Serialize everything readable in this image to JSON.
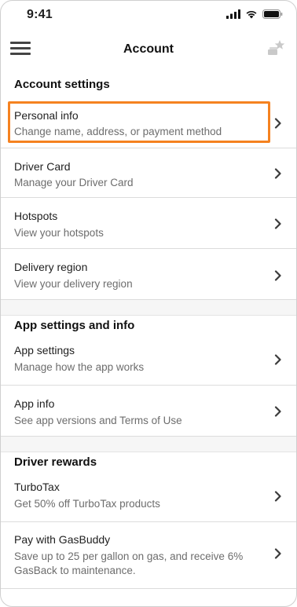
{
  "status_bar": {
    "time": "9:41"
  },
  "nav": {
    "title": "Account",
    "left_icon": "menu-icon",
    "right_icon": "star-stack-icon"
  },
  "sections": {
    "account": {
      "title": "Account settings",
      "items": [
        {
          "title": "Personal info",
          "subtitle": "Change name, address, or payment method"
        },
        {
          "title": "Driver Card",
          "subtitle": "Manage your Driver Card"
        },
        {
          "title": "Hotspots",
          "subtitle": "View your hotspots"
        },
        {
          "title": "Delivery region",
          "subtitle": "View your delivery region"
        }
      ]
    },
    "app": {
      "title": "App settings and info",
      "items": [
        {
          "title": "App settings",
          "subtitle": "Manage how the app works"
        },
        {
          "title": "App info",
          "subtitle": "See app versions and Terms of Use"
        }
      ]
    },
    "rewards": {
      "title": "Driver rewards",
      "items": [
        {
          "title": "TurboTax",
          "subtitle": "Get 50% off TurboTax products"
        },
        {
          "title": "Pay with GasBuddy",
          "subtitle": "Save up to 25 per gallon on gas, and receive 6% GasBack to maintenance."
        }
      ]
    }
  },
  "colors": {
    "highlight": "#f58220",
    "subtitle": "#6d6d6d",
    "divider": "#dcdcdc",
    "section_gap": "#f6f6f6"
  }
}
